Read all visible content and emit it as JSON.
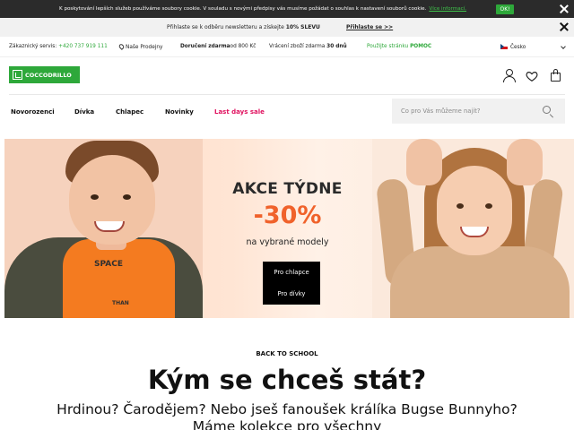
{
  "cookie_bar": {
    "text": "K poskytování lepších služeb používáme soubory cookie. V souladu s novými předpisy vás musíme požádat o souhlas k nastavení souborů cookie.",
    "link": "Více informací.",
    "ok_label": "OK!"
  },
  "newsletter_bar": {
    "text": "Přihlaste se k odběru newsletteru a získejte",
    "highlight": "10% SLEVU",
    "cta": "Přihlaste se >>"
  },
  "info_bar": {
    "service_label": "Zákaznický servis:",
    "service_phone": "+420 737 919 111",
    "stores": "Naše Prodejny",
    "free_delivery_bold": "Doručení zdarma",
    "free_delivery_rest": "od 800 Kč",
    "returns_text": "Vrácení zboží zdarma",
    "returns_bold": "30 dnů",
    "help_text": "Použijte stránku",
    "help_bold": "POMOC",
    "country": "Česko"
  },
  "header": {
    "logo_text": "COCCODRILLO",
    "icons": [
      "user-icon",
      "heart-icon",
      "bag-icon"
    ]
  },
  "nav": {
    "items": [
      "Novorozenci",
      "Dívka",
      "Chlapec",
      "Novinky",
      "Last days sale"
    ],
    "search_placeholder": "Co pro Vás můžeme najít?"
  },
  "banner": {
    "title": "AKCE TÝDNE",
    "discount": "-30%",
    "subtitle": "na vybrané modely",
    "buttons": [
      "Pro chlapce",
      "Pro dívky"
    ],
    "shirt_print": "SPACE",
    "shirt_print_2": "THAN"
  },
  "content": {
    "kicker": "BACK TO SCHOOL",
    "headline": "Kým se chceš stát?",
    "paragraph_line1": "Hrdinou? Čarodějem? Nebo jseš fanoušek králíka Bugse Bunnyho?",
    "paragraph_line2": "Máme kolekce pro všechny"
  },
  "colors": {
    "brand_green": "#2ea83a",
    "sale_pink": "#e0115f",
    "discount_orange": "#f0622b",
    "cookie_bg": "#2b2b2b"
  }
}
